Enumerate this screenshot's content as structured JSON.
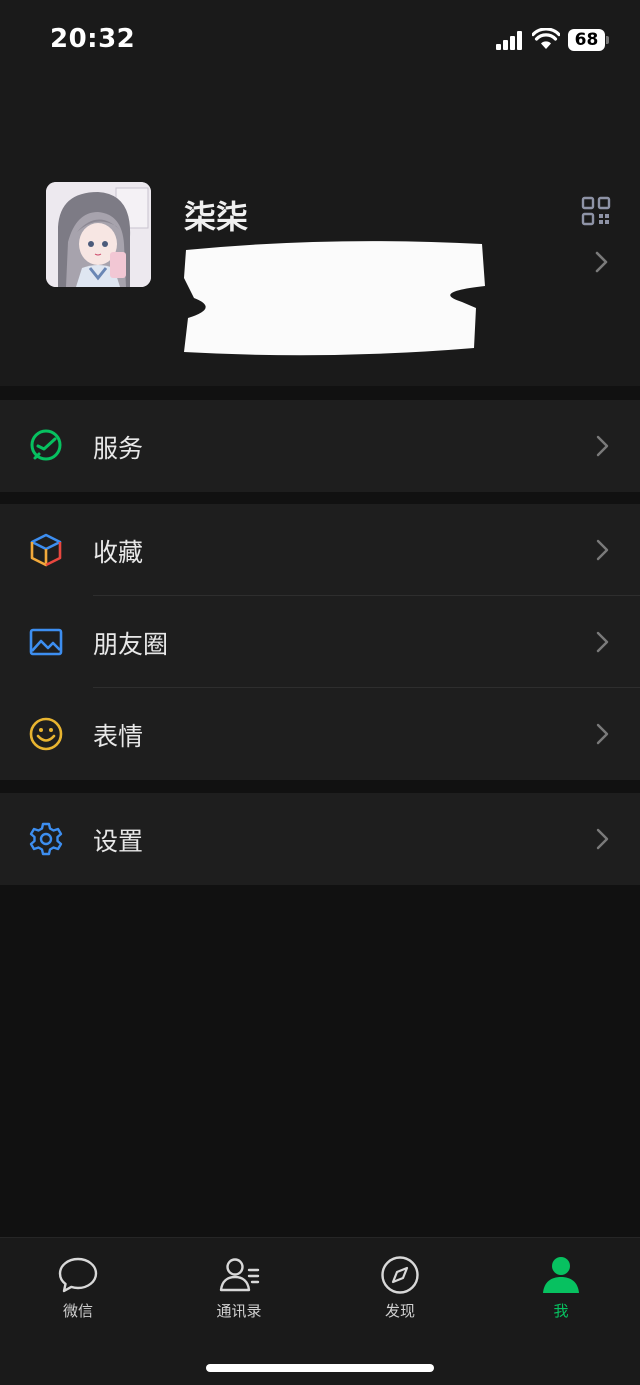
{
  "status_bar": {
    "time": "20:32",
    "battery": "68"
  },
  "profile": {
    "name": "柒柒",
    "avatar_icon": "anime-avatar",
    "qr_icon": "qr-code-icon"
  },
  "menu_groups": [
    [
      {
        "label": "服务",
        "icon": "service-icon",
        "color": "#07c160"
      }
    ],
    [
      {
        "label": "收藏",
        "icon": "favorites-cube-icon",
        "color": "#f2a93b"
      },
      {
        "label": "朋友圈",
        "icon": "moments-image-icon",
        "color": "#3d8ef0"
      },
      {
        "label": "表情",
        "icon": "sticker-smile-icon",
        "color": "#e8b430"
      }
    ],
    [
      {
        "label": "设置",
        "icon": "settings-gear-icon",
        "color": "#3d8ef0"
      }
    ]
  ],
  "tab_bar": {
    "tabs": [
      {
        "label": "微信",
        "icon": "chat-bubble-icon"
      },
      {
        "label": "通讯录",
        "icon": "contacts-icon"
      },
      {
        "label": "发现",
        "icon": "compass-icon"
      },
      {
        "label": "我",
        "icon": "person-icon",
        "active": true
      }
    ],
    "accent_color": "#07c160"
  }
}
